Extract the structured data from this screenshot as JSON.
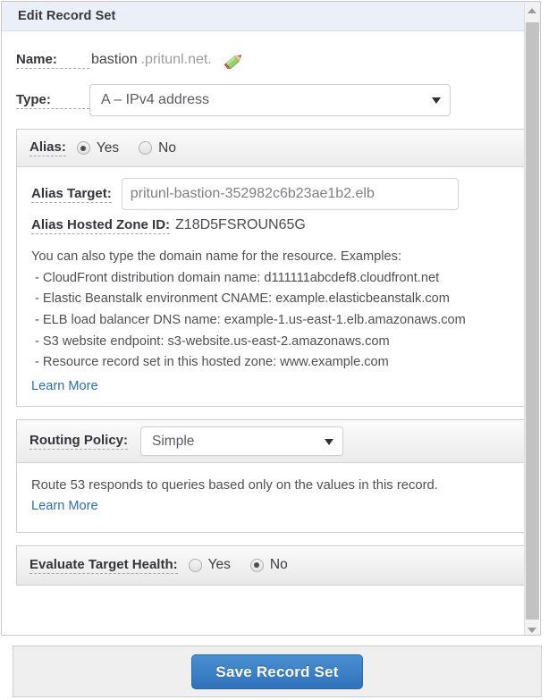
{
  "panel": {
    "title": "Edit Record Set"
  },
  "name_field": {
    "label": "Name:",
    "value": "bastion",
    "suffix": ".pritunl.net.",
    "edit_icon": "pencil-icon"
  },
  "type_field": {
    "label": "Type:",
    "value": "A – IPv4 address"
  },
  "alias": {
    "label": "Alias:",
    "options": [
      {
        "label": "Yes",
        "selected": true
      },
      {
        "label": "No",
        "selected": false
      }
    ],
    "target": {
      "label": "Alias Target:",
      "value": "pritunl-bastion-352982c6b23ae1b2.elb"
    },
    "hosted_zone": {
      "label": "Alias Hosted Zone ID:",
      "value": "Z18D5FSROUN65G"
    },
    "help": {
      "intro": "You can also type the domain name for the resource. Examples:",
      "items": [
        "-  CloudFront distribution domain name: d111111abcdef8.cloudfront.net",
        "-  Elastic Beanstalk environment CNAME: example.elasticbeanstalk.com",
        "-  ELB load balancer DNS name: example-1.us-east-1.elb.amazonaws.com",
        "-  S3 website endpoint: s3-website.us-east-2.amazonaws.com",
        "-  Resource record set in this hosted zone: www.example.com"
      ],
      "learn_more": "Learn More"
    }
  },
  "routing_policy": {
    "label": "Routing Policy:",
    "value": "Simple",
    "description": "Route 53 responds to queries based only on the values in this record.",
    "learn_more": "Learn More"
  },
  "evaluate_target_health": {
    "label": "Evaluate Target Health:",
    "options": [
      {
        "label": "Yes",
        "selected": false
      },
      {
        "label": "No",
        "selected": true
      }
    ]
  },
  "footer": {
    "save_label": "Save Record Set"
  },
  "colors": {
    "header_bg": "#eaeff8",
    "accent_blue": "#2a6ebb",
    "save_button": "#2f72bd",
    "link": "#2a6ebb"
  }
}
